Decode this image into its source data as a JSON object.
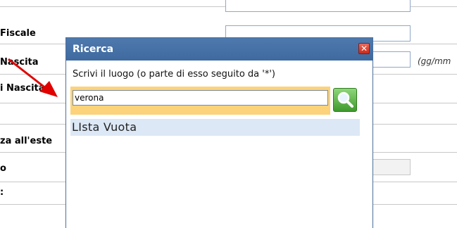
{
  "form": {
    "labels": [
      "Fiscale",
      "Nascita",
      "i Nascita",
      "za all'este",
      "o",
      ":"
    ],
    "hint": "(gg/mm"
  },
  "dialog": {
    "title": "Ricerca",
    "close_label": "✕",
    "prompt": "Scrivi il luogo (o parte di esso seguito da '*')",
    "search_value": "verona",
    "result_text": "LIsta Vuota"
  },
  "colors": {
    "titlebar": "#4674aa",
    "search_highlight": "#fcd37a",
    "result_bg": "#dde8f6",
    "search_button": "#4fae3a",
    "arrow": "#e00000"
  },
  "icons": {
    "search_button": "magnifier-icon",
    "close": "close-icon"
  }
}
